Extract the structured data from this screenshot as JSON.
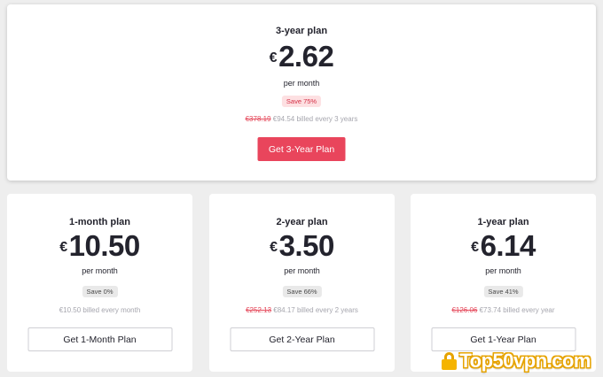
{
  "featured": {
    "title": "3-year plan",
    "currency": "€",
    "price": "2.62",
    "per": "per month",
    "save": "Save 75%",
    "old_price": "€378.19",
    "billed": " €94.54 billed every 3 years",
    "button": "Get 3-Year Plan"
  },
  "plans": [
    {
      "title": "1-month plan",
      "currency": "€",
      "price": "10.50",
      "per": "per month",
      "save": "Save 0%",
      "old_price": "",
      "billed": "€10.50 billed every month",
      "button": "Get 1-Month Plan"
    },
    {
      "title": "2-year plan",
      "currency": "€",
      "price": "3.50",
      "per": "per month",
      "save": "Save 66%",
      "old_price": "€252.13",
      "billed": " €84.17 billed every 2 years",
      "button": "Get 2-Year Plan"
    },
    {
      "title": "1-year plan",
      "currency": "€",
      "price": "6.14",
      "per": "per month",
      "save": "Save 41%",
      "old_price": "€126.06",
      "billed": " €73.74 billed every year",
      "button": "Get 1-Year Plan"
    }
  ],
  "watermark": {
    "text": "Top50vpn.com",
    "icon": "padlock-icon"
  },
  "colors": {
    "accent": "#e9455c",
    "save_badge_bg": "#fde0e2",
    "strike_price": "#e5485a",
    "background": "#eeeeee"
  }
}
